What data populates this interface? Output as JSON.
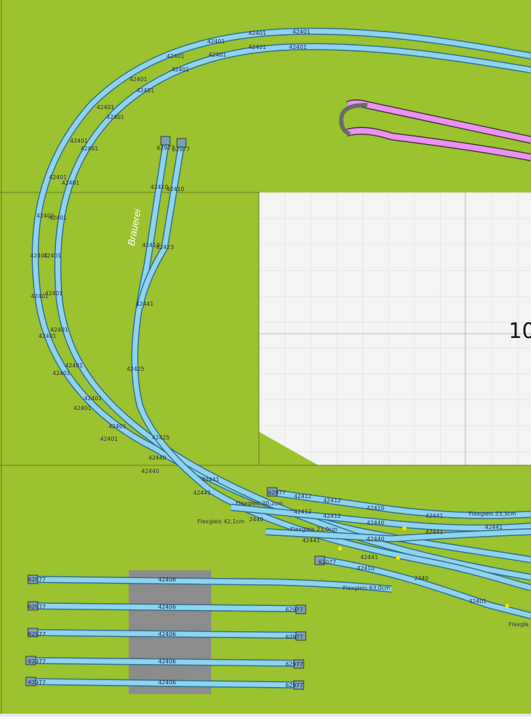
{
  "colors": {
    "baseboard": "#9bc22f",
    "grid_bg": "#f2f2f2",
    "rail": "#8fd3ee",
    "rail_edge": "#2f6f8f",
    "pink_rail": "#ee8ff2",
    "platform": "#8c8c8c",
    "marker": "#f5e400"
  },
  "region_label": "Brauerei",
  "grid_number": "10",
  "top_track": {
    "outer": [
      "42401",
      "42401",
      "42401",
      "42401",
      "42401",
      "42401",
      "42401",
      "42401",
      "42401",
      "42401",
      "42401",
      "42401",
      "42401"
    ],
    "inner": [
      "42401",
      "42401",
      "42401",
      "42401",
      "42401",
      "42401",
      "42401",
      "42401",
      "42401",
      "42401",
      "42401",
      "42401",
      "42401"
    ]
  },
  "siding_labels": [
    "62977",
    "62977",
    "42410",
    "42410",
    "42410",
    "42423",
    "42441",
    "42425",
    "42425"
  ],
  "junction_labels": [
    {
      "t": "42440"
    },
    {
      "t": "42440"
    },
    {
      "t": "42441"
    },
    {
      "t": "42441"
    },
    {
      "t": "Flexgleis 20,2cm"
    },
    {
      "t": "Flexgleis 42,1cm"
    },
    {
      "t": "2440"
    },
    {
      "t": "62977"
    },
    {
      "t": "42412"
    },
    {
      "t": "42412"
    },
    {
      "t": "42412"
    },
    {
      "t": "42412"
    },
    {
      "t": "42410"
    },
    {
      "t": "42440"
    },
    {
      "t": "42440"
    },
    {
      "t": "Flexgleis 23,0cm"
    },
    {
      "t": "42441"
    },
    {
      "t": "42441"
    },
    {
      "t": "42441"
    },
    {
      "t": "Flexgleis 23,3cm"
    },
    {
      "t": "42441"
    },
    {
      "t": "62077"
    },
    {
      "t": "42441"
    },
    {
      "t": "42410"
    },
    {
      "t": "2440"
    },
    {
      "t": "42401"
    },
    {
      "t": "Flexgleis 63,0cm"
    },
    {
      "t": "Flexgle"
    }
  ],
  "yard_tracks": [
    {
      "buffer_left": "62977",
      "label": "42406",
      "buffer_right": ""
    },
    {
      "buffer_left": "62977",
      "label": "42406",
      "buffer_right": "62977"
    },
    {
      "buffer_left": "62977",
      "label": "42406",
      "buffer_right": "62977"
    },
    {
      "buffer_left": "62977",
      "label": "42406",
      "buffer_right": "62977"
    },
    {
      "buffer_left": "62977",
      "label": "42406",
      "buffer_right": "62977"
    }
  ]
}
